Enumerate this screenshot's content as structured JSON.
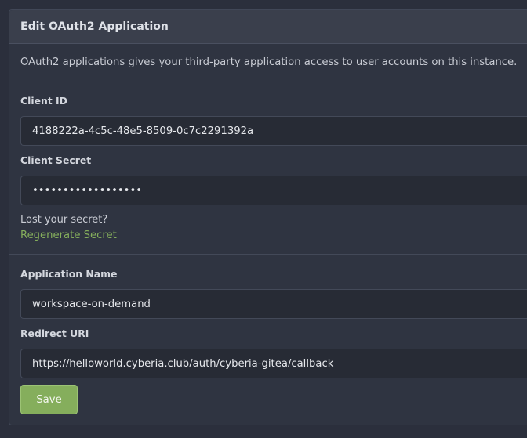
{
  "panel": {
    "title": "Edit OAuth2 Application",
    "description": "OAuth2 applications gives your third-party application access to user accounts on this instance."
  },
  "client_id": {
    "label": "Client ID",
    "value": "4188222a-4c5c-48e5-8509-0c7c2291392a"
  },
  "client_secret": {
    "label": "Client Secret",
    "value": "••••••••••••••••••"
  },
  "secret_help": {
    "text": "Lost your secret?",
    "link": "Regenerate Secret"
  },
  "application_name": {
    "label": "Application Name",
    "value": "workspace-on-demand"
  },
  "redirect_uri": {
    "label": "Redirect URI",
    "value": "https://helloworld.cyberia.club/auth/cyberia-gitea/callback"
  },
  "save_button": {
    "label": "Save"
  },
  "colors": {
    "background": "#2b2f3c",
    "panel": "#2f3441",
    "header": "#3a3f4c",
    "input": "#272b35",
    "accent": "#85ae5c"
  }
}
